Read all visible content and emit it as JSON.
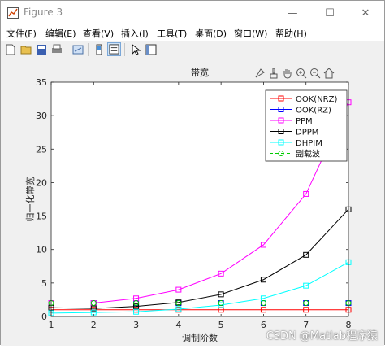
{
  "window": {
    "title": "Figure 3",
    "minimize_glyph": "—",
    "maximize_glyph": "☐",
    "close_glyph": "✕",
    "dock_glyph": "↘"
  },
  "menu": [
    "文件(F)",
    "编辑(E)",
    "查看(V)",
    "插入(I)",
    "工具(T)",
    "桌面(D)",
    "窗口(W)",
    "帮助(H)"
  ],
  "toolbar": [
    "new-figure-icon",
    "open-file-icon",
    "save-icon",
    "print-icon",
    "link-plot-icon",
    "insert-colorbar-icon",
    "insert-legend-icon",
    "edit-plot-icon",
    "property-inspector-icon"
  ],
  "axes_toolbar": [
    "data-tips-icon",
    "brush-icon",
    "pan-icon",
    "zoom-in-icon",
    "zoom-out-icon",
    "home-icon"
  ],
  "watermark": "CSDN @Matlab程序猿",
  "colors": {
    "OOK(NRZ)": "#ff0000",
    "OOK(RZ)": "#0000ff",
    "PPM": "#ff00ff",
    "DPPM": "#000000",
    "DHPIM": "#00ffff",
    "副载波": "#00cc00"
  },
  "chart_data": {
    "type": "line",
    "title": "带宽",
    "xlabel": "调制阶数",
    "ylabel": "归一化带宽",
    "xlim": [
      1,
      8
    ],
    "ylim": [
      0,
      35
    ],
    "xticks": [
      1,
      2,
      3,
      4,
      5,
      6,
      7,
      8
    ],
    "yticks": [
      0,
      5,
      10,
      15,
      20,
      25,
      30,
      35
    ],
    "grid": false,
    "legend_position": "top-right",
    "x": [
      1,
      2,
      3,
      4,
      5,
      6,
      7,
      8
    ],
    "series": [
      {
        "name": "OOK(NRZ)",
        "color": "#ff0000",
        "marker": "square",
        "dashed": false,
        "values": [
          1,
          1,
          1,
          1,
          1,
          1,
          1,
          1
        ]
      },
      {
        "name": "OOK(RZ)",
        "color": "#0000ff",
        "marker": "square",
        "dashed": false,
        "values": [
          2,
          2,
          2,
          2,
          2,
          2,
          2,
          2
        ]
      },
      {
        "name": "PPM",
        "color": "#ff00ff",
        "marker": "square",
        "dashed": false,
        "values": [
          2,
          2,
          2.7,
          4,
          6.4,
          10.7,
          18.3,
          32
        ]
      },
      {
        "name": "DPPM",
        "color": "#000000",
        "marker": "square",
        "dashed": false,
        "values": [
          1.3,
          1.2,
          1.5,
          2.1,
          3.3,
          5.5,
          9.2,
          16
        ]
      },
      {
        "name": "DHPIM",
        "color": "#00ffff",
        "marker": "square",
        "dashed": false,
        "values": [
          0.5,
          0.6,
          0.7,
          1.1,
          1.7,
          2.7,
          4.6,
          8.1
        ]
      },
      {
        "name": "副载波",
        "color": "#00cc00",
        "marker": "circle",
        "dashed": true,
        "values": [
          2,
          2,
          2,
          2,
          2,
          2,
          2,
          2
        ]
      }
    ]
  }
}
